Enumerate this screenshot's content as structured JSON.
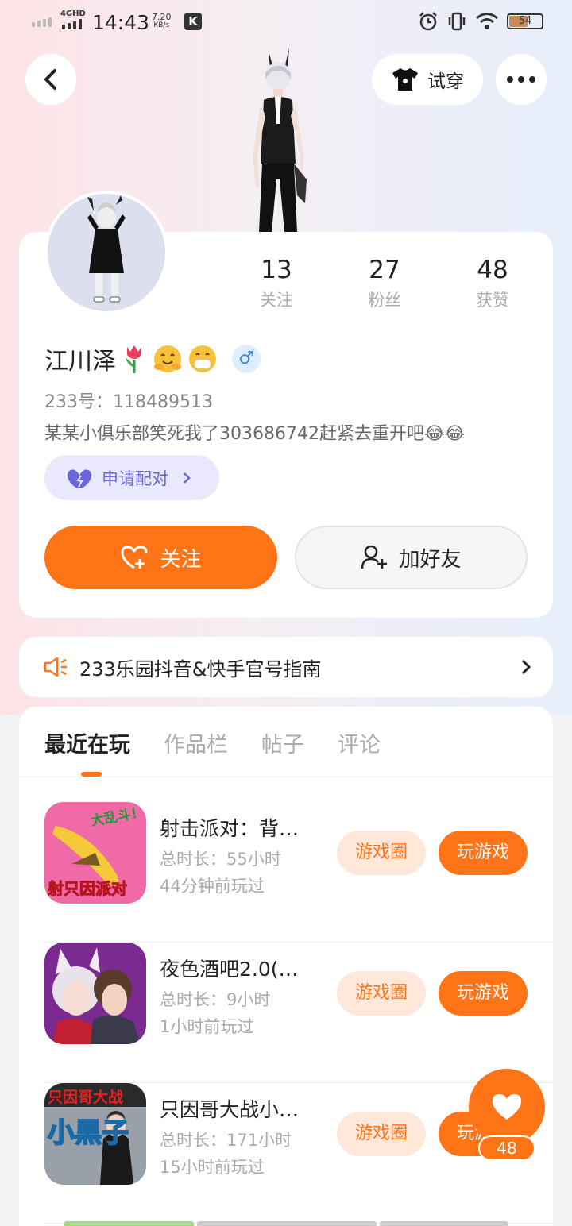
{
  "status_bar": {
    "network": "4GHD",
    "time": "14:43",
    "speed_value": "7.20",
    "speed_unit": "KB/s",
    "app_badge": "K",
    "battery": "54"
  },
  "header": {
    "tryon_label": "试穿"
  },
  "profile": {
    "stats": [
      {
        "num": "13",
        "label": "关注"
      },
      {
        "num": "27",
        "label": "粉丝"
      },
      {
        "num": "48",
        "label": "获赞"
      }
    ],
    "name": "江川泽",
    "gender_symbol": "♂",
    "uid": "233号：118489513",
    "bio": "某某小俱乐部笑死我了303686742赶紧去重开吧😂😂",
    "pair_label": "申请配对",
    "follow_label": "关注",
    "add_friend_label": "加好友"
  },
  "notice": {
    "text": "233乐园抖音&快手官号指南"
  },
  "tabs": [
    "最近在玩",
    "作品栏",
    "帖子",
    "评论"
  ],
  "games": [
    {
      "title": "射击派对：背…",
      "duration": "总时长：55小时",
      "last": "44分钟前玩过",
      "icon_text_top": "大乱斗！",
      "icon_text_bottom": "射只因派对"
    },
    {
      "title": "夜色酒吧2.0(…",
      "duration": "总时长：9小时",
      "last": "1小时前玩过"
    },
    {
      "title": "只因哥大战小…",
      "duration": "总时长：171小时",
      "last": "15小时前玩过",
      "icon_text_top": "只因哥大战",
      "icon_text_bottom": "小黑子"
    }
  ],
  "game_actions": {
    "circle_label": "游戏圈",
    "play_label": "玩游戏"
  },
  "like_fab": {
    "count": "48"
  },
  "colors": {
    "accent": "#ff7417",
    "pair_bg": "#e9e8fd",
    "pair_text": "#6a67d8"
  }
}
